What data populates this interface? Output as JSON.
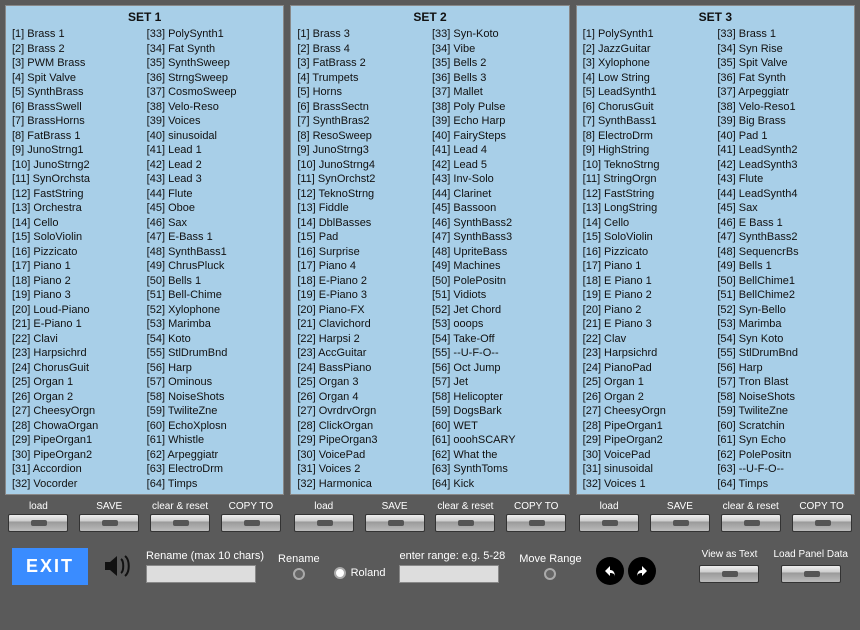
{
  "sets": [
    {
      "title": "SET 1",
      "items": [
        "Brass 1",
        "Brass 2",
        "PWM Brass",
        "Spit Valve",
        "SynthBrass",
        "BrassSwell",
        "BrassHorns",
        "FatBrass 1",
        "JunoStrng1",
        "JunoStrng2",
        "SynOrchsta",
        "FastString",
        "Orchestra",
        "Cello",
        "SoloViolin",
        "Pizzicato",
        "Piano 1",
        "Piano 2",
        "Piano 3",
        "Loud-Piano",
        "E-Piano 1",
        "Clavi",
        "Harpsichrd",
        "ChorusGuit",
        "Organ 1",
        "Organ 2",
        "CheesyOrgn",
        "ChowaOrgan",
        "PipeOrgan1",
        "PipeOrgan2",
        "Accordion",
        "Vocorder",
        "PolySynth1",
        "Fat Synth",
        "SynthSweep",
        "StrngSweep",
        "CosmoSweep",
        "Velo-Reso",
        "Voices",
        "sinusoidal",
        "Lead 1",
        "Lead 2",
        "Lead 3",
        "Flute",
        "Oboe",
        "Sax",
        "E-Bass 1",
        "SynthBass1",
        "ChrusPluck",
        "Bells 1",
        "Bell-Chime",
        "Xylophone",
        "Marimba",
        "Koto",
        "StlDrumBnd",
        "Harp",
        "Ominous",
        "NoiseShots",
        "TwiliteZne",
        "EchoXplosn",
        "Whistle",
        "Arpeggiatr",
        "ElectroDrm",
        "Timps"
      ]
    },
    {
      "title": "SET 2",
      "items": [
        "Brass 3",
        "Brass 4",
        "FatBrass 2",
        "Trumpets",
        "Horns",
        "BrassSectn",
        "SynthBras2",
        "ResoSweep",
        "JunoStrng3",
        "JunoStrng4",
        "SynOrchst2",
        "TeknoStrng",
        "Fiddle",
        "DblBasses",
        "Pad",
        "Surprise",
        "Piano 4",
        "E-Piano 2",
        "E-Piano 3",
        "Piano-FX",
        "Clavichord",
        "Harpsi 2",
        "AccGuitar",
        "BassPiano",
        "Organ 3",
        "Organ 4",
        "OvrdrvOrgn",
        "ClickOrgan",
        "PipeOrgan3",
        "VoicePad",
        "Voices 2",
        "Harmonica",
        "Syn-Koto",
        "Vibe",
        "Bells 2",
        "Bells 3",
        "Mallet",
        "Poly Pulse",
        "Echo Harp",
        "FairySteps",
        "Lead 4",
        "Lead 5",
        "Inv-Solo",
        "Clarinet",
        "Bassoon",
        "SynthBass2",
        "SynthBass3",
        "UpriteBass",
        "Machines",
        "PolePositn",
        "Vidiots",
        "Jet Chord",
        "ooops",
        "Take-Off",
        "--U-F-O--",
        "Oct Jump",
        "Jet",
        "Helicopter",
        "DogsBark",
        "WET",
        "ooohSCARY",
        "What the",
        "SynthToms",
        "Kick"
      ]
    },
    {
      "title": "SET 3",
      "items": [
        "PolySynth1",
        "JazzGuitar",
        "Xylophone",
        "Low String",
        "LeadSynth1",
        "ChorusGuit",
        "SynthBass1",
        "ElectroDrm",
        "HighString",
        "TeknoStrng",
        "StringOrgn",
        "FastString",
        "LongString",
        "Cello",
        "SoloViolin",
        "Pizzicato",
        "Piano 1",
        "E Piano 1",
        "E Piano 2",
        "Piano 2",
        "E Piano 3",
        "Clav",
        "Harpsichrd",
        "PianoPad",
        "Organ 1",
        "Organ 2",
        "CheesyOrgn",
        "PipeOrgan1",
        "PipeOrgan2",
        "VoicePad",
        "sinusoidal",
        "Voices 1",
        "Brass 1",
        "Syn Rise",
        "Spit Valve",
        "Fat Synth",
        "Arpeggiatr",
        "Velo-Reso1",
        "Big Brass",
        "Pad 1",
        "LeadSynth2",
        "LeadSynth3",
        "Flute",
        "LeadSynth4",
        "Sax",
        "E Bass 1",
        "SynthBass2",
        "SequencrBs",
        "Bells 1",
        "BellChime1",
        "BellChime2",
        "Syn-Bello",
        "Marimba",
        "Syn Koto",
        "StlDrumBnd",
        "Harp",
        "Tron Blast",
        "NoiseShots",
        "TwiliteZne",
        "Scratchin",
        "Syn Echo",
        "PolePositn",
        "--U-F-O--",
        "Timps"
      ]
    }
  ],
  "panel_buttons": {
    "load": "load",
    "save": "SAVE",
    "clear": "clear & reset",
    "copy": "COPY TO"
  },
  "bottom": {
    "exit": "EXIT",
    "rename_label": "Rename (max 10 chars)",
    "rename_btn": "Rename",
    "roland": "Roland",
    "range_label": "enter range: e.g. 5-28",
    "move_range": "Move Range",
    "view_text": "View as Text",
    "load_panel": "Load Panel Data"
  },
  "chart_data": null
}
